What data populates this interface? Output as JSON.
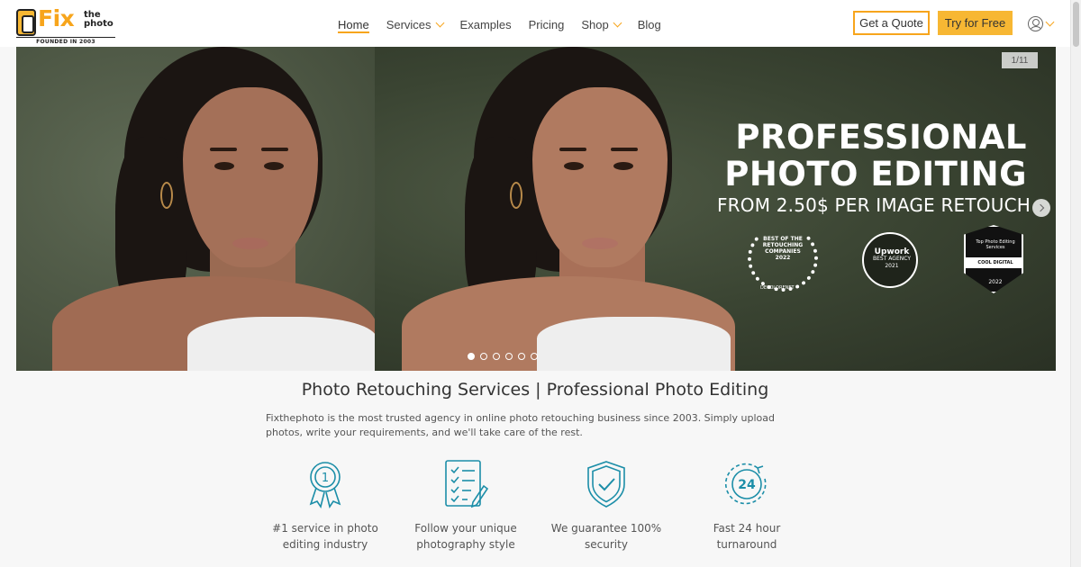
{
  "logo": {
    "brand": "Fix",
    "sub": "the photo",
    "founded": "FOUNDED IN 2003"
  },
  "nav": {
    "items": [
      {
        "label": "Home",
        "active": true,
        "dropdown": false
      },
      {
        "label": "Services",
        "active": false,
        "dropdown": true
      },
      {
        "label": "Examples",
        "active": false,
        "dropdown": false
      },
      {
        "label": "Pricing",
        "active": false,
        "dropdown": false
      },
      {
        "label": "Shop",
        "active": false,
        "dropdown": true
      },
      {
        "label": "Blog",
        "active": false,
        "dropdown": false
      }
    ],
    "quote_label": "Get a Quote",
    "try_label": "Try for Free"
  },
  "hero": {
    "counter": "1/11",
    "title_line1": "PROFESSIONAL",
    "title_line2": "PHOTO EDITING",
    "subtitle": "FROM 2.50$ PER IMAGE RETOUCH",
    "awards": {
      "a1": {
        "text": "BEST OF THE RETOUCHING COMPANIES 2022",
        "foot": "DECOLORENET"
      },
      "a2": {
        "brand": "Upwork",
        "text": "BEST AGENCY 2021"
      },
      "a3": {
        "text": "Top Photo Editing Services",
        "ribbon": "COOL DIGITAL",
        "year": "2022"
      }
    },
    "slides_total": 6,
    "slide_active": 1
  },
  "section": {
    "title": "Photo Retouching Services | Professional Photo Editing",
    "intro": "Fixthephoto is the most trusted agency in online photo retouching business since 2003. Simply upload photos, write your requirements, and we'll take care of the rest."
  },
  "features": [
    {
      "icon": "award-ribbon-icon",
      "label": "#1 service in photo editing industry"
    },
    {
      "icon": "checklist-icon",
      "label": "Follow your unique photography style"
    },
    {
      "icon": "shield-check-icon",
      "label": "We guarantee 100% security"
    },
    {
      "icon": "clock-24-icon",
      "label": "Fast 24 hour turnaround"
    }
  ],
  "colors": {
    "accent": "#f7a51c",
    "button_fill": "#f7b733",
    "icon_teal": "#1c8ea8"
  }
}
